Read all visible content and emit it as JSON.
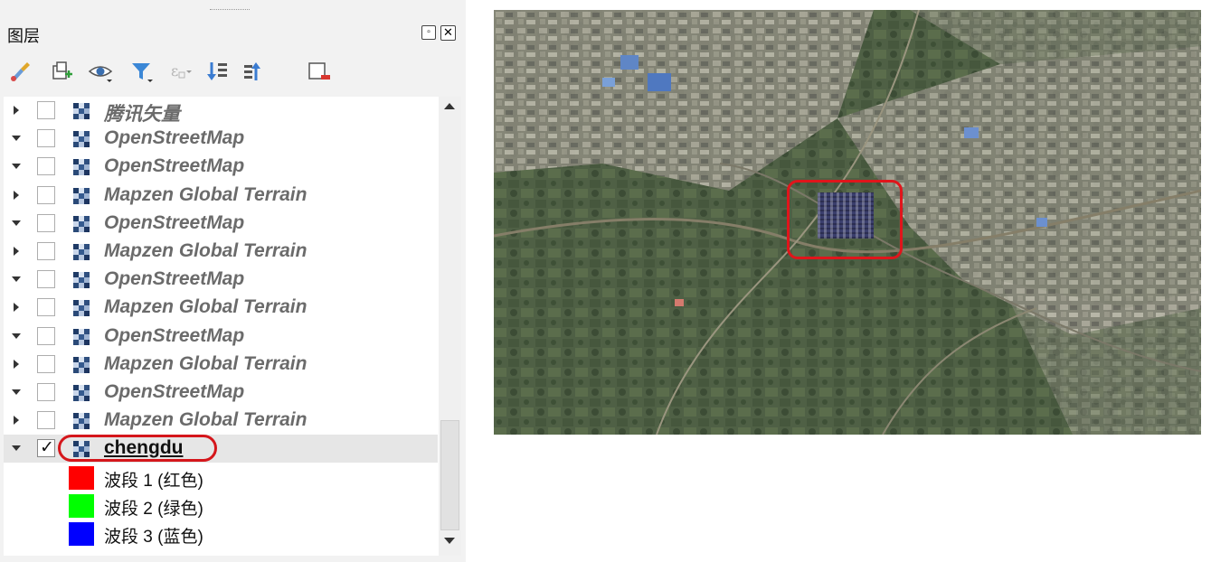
{
  "panel": {
    "title": "图层",
    "float_label": "▫",
    "close_label": "✕",
    "toolbar": [
      {
        "name": "style-manager-icon"
      },
      {
        "name": "add-group-icon"
      },
      {
        "name": "visibility-icon"
      },
      {
        "name": "filter-legend-icon"
      },
      {
        "name": "filter-expression-icon"
      },
      {
        "name": "expand-all-icon"
      },
      {
        "name": "collapse-all-icon"
      },
      {
        "name": "remove-layer-icon"
      }
    ]
  },
  "layers": [
    {
      "name": "腾讯矢量",
      "expanded": false,
      "checked": false
    },
    {
      "name": "OpenStreetMap",
      "expanded": true,
      "checked": false
    },
    {
      "name": "OpenStreetMap",
      "expanded": true,
      "checked": false
    },
    {
      "name": "Mapzen Global Terrain",
      "expanded": false,
      "checked": false
    },
    {
      "name": "OpenStreetMap",
      "expanded": true,
      "checked": false
    },
    {
      "name": "Mapzen Global Terrain",
      "expanded": false,
      "checked": false
    },
    {
      "name": "OpenStreetMap",
      "expanded": true,
      "checked": false
    },
    {
      "name": "Mapzen Global Terrain",
      "expanded": false,
      "checked": false
    },
    {
      "name": "OpenStreetMap",
      "expanded": true,
      "checked": false
    },
    {
      "name": "Mapzen Global Terrain",
      "expanded": false,
      "checked": false
    },
    {
      "name": "OpenStreetMap",
      "expanded": true,
      "checked": false
    },
    {
      "name": "Mapzen Global Terrain",
      "expanded": false,
      "checked": false
    },
    {
      "name": "chengdu",
      "expanded": true,
      "checked": true,
      "active": true
    }
  ],
  "bands": [
    {
      "label": "波段 1 (红色)",
      "color": "#ff0000"
    },
    {
      "label": "波段 2 (绿色)",
      "color": "#00ff00"
    },
    {
      "label": "波段 3 (蓝色)",
      "color": "#0000ff"
    }
  ],
  "colors": {
    "highlight": "#d5161b",
    "inactive_text": "#6b6b6b",
    "active_text": "#111111"
  }
}
